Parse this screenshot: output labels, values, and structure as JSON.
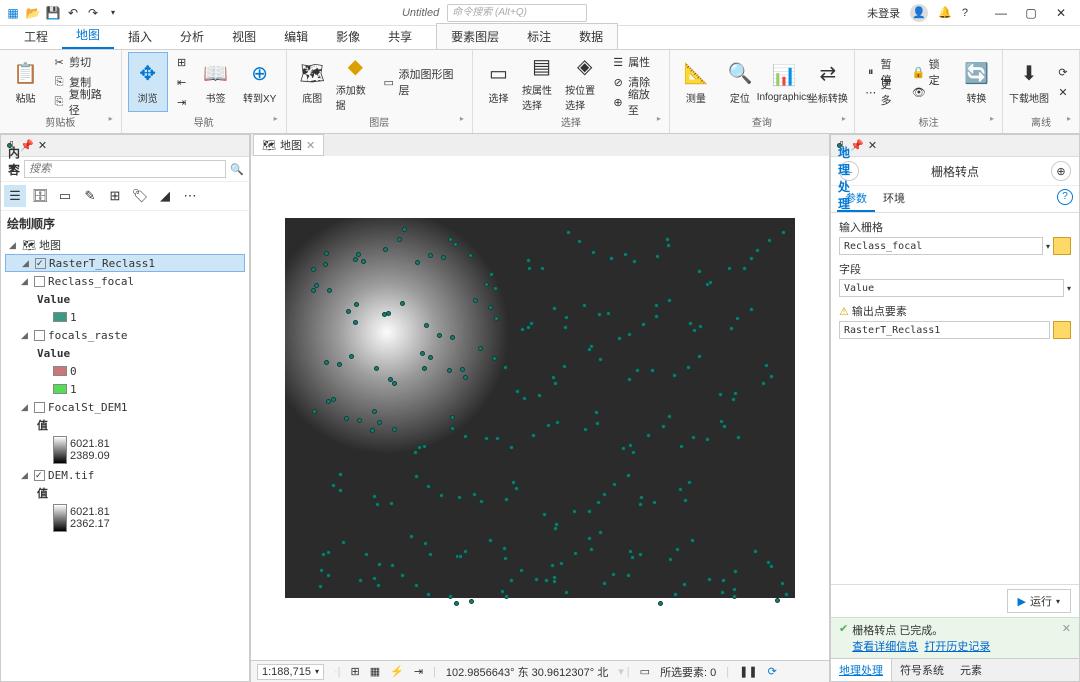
{
  "titlebar": {
    "doc_title": "Untitled",
    "search_placeholder": "命令搜索 (Alt+Q)",
    "login": "未登录"
  },
  "ribbon_tabs": [
    "工程",
    "地图",
    "插入",
    "分析",
    "视图",
    "编辑",
    "影像",
    "共享"
  ],
  "ribbon_ctx_tabs": [
    "要素图层",
    "标注",
    "数据"
  ],
  "ribbon": {
    "clipboard": {
      "label": "剪贴板",
      "paste": "粘贴",
      "cut": "剪切",
      "copy": "复制",
      "copypath": "复制路径"
    },
    "nav": {
      "label": "导航",
      "browse": "浏览",
      "bookmark": "书签",
      "goto": "转到XY"
    },
    "layer": {
      "label": "图层",
      "basemap": "底图",
      "adddata": "添加数据",
      "addgraphic": "添加图形图层"
    },
    "select": {
      "label": "选择",
      "select": "选择",
      "byattr": "按属性选择",
      "byloc": "按位置选择",
      "attr": "属性",
      "clear": "清除",
      "zoom": "缩放至"
    },
    "query": {
      "label": "查询",
      "measure": "测量",
      "locate": "定位",
      "info": "Infographics",
      "coord": "坐标转换"
    },
    "annot": {
      "label": "标注",
      "pause": "暂停",
      "lock": "锁定",
      "more": "更多"
    },
    "convert": "转换",
    "offline": {
      "label": "离线",
      "download": "下载地图"
    }
  },
  "contents": {
    "title": "内容",
    "search_placeholder": "搜索",
    "draw_order": "绘制顺序",
    "map_name": "地图",
    "layers": [
      {
        "name": "RasterT_Reclass1",
        "checked": true,
        "selected": true
      },
      {
        "name": "Reclass_focal",
        "checked": false,
        "value_label": "Value",
        "classes": [
          {
            "v": "1",
            "c": "#3a9b84"
          }
        ]
      },
      {
        "name": "focals_raste",
        "checked": false,
        "value_label": "Value",
        "classes": [
          {
            "v": "0",
            "c": "#c77"
          },
          {
            "v": "1",
            "c": "#5d5"
          }
        ]
      },
      {
        "name": "FocalSt_DEM1",
        "checked": false,
        "value_label": "值",
        "range": [
          "6021.81",
          "2389.09"
        ]
      },
      {
        "name": "DEM.tif",
        "checked": true,
        "value_label": "值",
        "range": [
          "6021.81",
          "2362.17"
        ]
      }
    ]
  },
  "map": {
    "tab": "地图",
    "scale": "1:188,715",
    "coords": "102.9856643° 东 30.9612307° 北",
    "sel": "所选要素: 0"
  },
  "gp": {
    "title": "地理处理",
    "tool": "栅格转点",
    "tabs": {
      "params": "参数",
      "env": "环境"
    },
    "p_in": "输入栅格",
    "v_in": "Reclass_focal",
    "p_field": "字段",
    "v_field": "Value",
    "p_out": "输出点要素",
    "v_out": "RasterT_Reclass1",
    "run": "运行",
    "msg_done": "栅格转点 已完成。",
    "msg_detail": "查看详细信息",
    "msg_hist": "打开历史记录",
    "btabs": [
      "地理处理",
      "符号系统",
      "元素"
    ]
  }
}
